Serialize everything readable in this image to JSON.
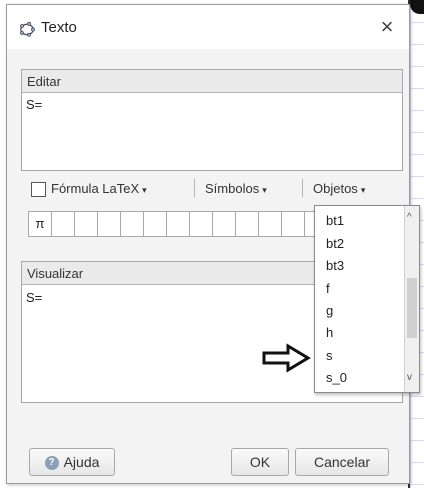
{
  "window": {
    "title": "Texto",
    "close_symbol": "×"
  },
  "edit_section": {
    "label": "Editar",
    "content": "S="
  },
  "toolbar": {
    "latex_label": "Fórmula LaTeX",
    "symbols_label": "Símbolos",
    "objects_label": "Objetos",
    "caret": "▾"
  },
  "symbol_row": {
    "first_symbol": "π"
  },
  "objects_menu": {
    "items": [
      "bt1",
      "bt2",
      "bt3",
      "f",
      "g",
      "h",
      "s",
      "s_0"
    ],
    "scroll_up": "^",
    "scroll_down": "v"
  },
  "preview_section": {
    "label": "Visualizar",
    "content": "S="
  },
  "buttons": {
    "help": "Ajuda",
    "ok": "OK",
    "cancel": "Cancelar"
  },
  "icons": {
    "title": "geogebra-icon",
    "close": "close-icon",
    "help": "help-icon",
    "pointer": "arrow-pointer-icon"
  }
}
